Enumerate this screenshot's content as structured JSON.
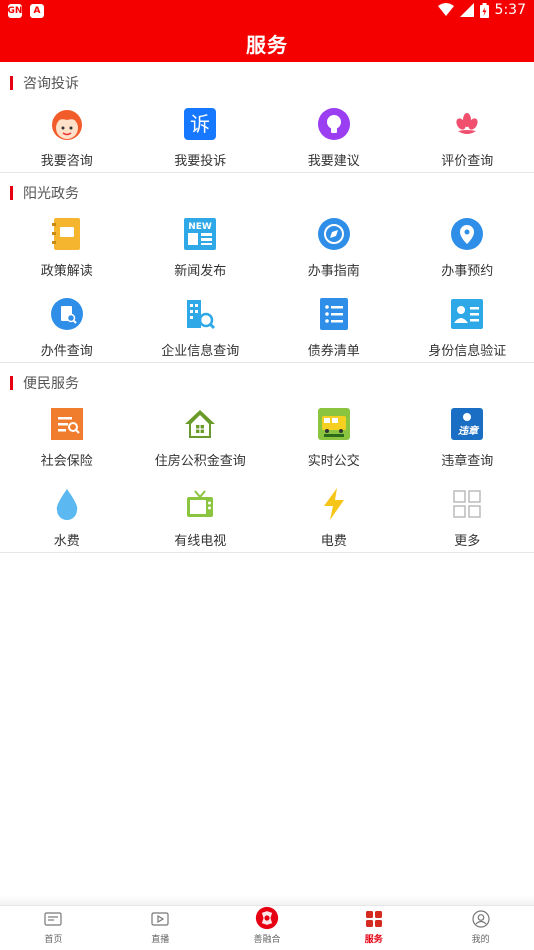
{
  "status": {
    "time": "5:37",
    "left_icons": [
      "GN",
      "A"
    ]
  },
  "header": {
    "title": "服务"
  },
  "sections": [
    {
      "title": "咨询投诉",
      "items": [
        {
          "label": "我要咨询",
          "icon": "avatar-face-icon"
        },
        {
          "label": "我要投诉",
          "icon": "complaint-icon"
        },
        {
          "label": "我要建议",
          "icon": "lightbulb-icon"
        },
        {
          "label": "评价查询",
          "icon": "flower-icon"
        }
      ]
    },
    {
      "title": "阳光政务",
      "items": [
        {
          "label": "政策解读",
          "icon": "notebook-icon"
        },
        {
          "label": "新闻发布",
          "icon": "newspaper-icon"
        },
        {
          "label": "办事指南",
          "icon": "compass-icon"
        },
        {
          "label": "办事预约",
          "icon": "location-pin-icon"
        },
        {
          "label": "办件查询",
          "icon": "document-search-icon"
        },
        {
          "label": "企业信息查询",
          "icon": "building-search-icon"
        },
        {
          "label": "债券清单",
          "icon": "list-icon"
        },
        {
          "label": "身份信息验证",
          "icon": "id-card-icon"
        }
      ]
    },
    {
      "title": "便民服务",
      "items": [
        {
          "label": "社会保险",
          "icon": "insurance-icon"
        },
        {
          "label": "住房公积金查询",
          "icon": "house-icon"
        },
        {
          "label": "实时公交",
          "icon": "bus-icon"
        },
        {
          "label": "违章查询",
          "icon": "traffic-violation-icon"
        },
        {
          "label": "水费",
          "icon": "water-drop-icon"
        },
        {
          "label": "有线电视",
          "icon": "tv-icon"
        },
        {
          "label": "电费",
          "icon": "lightning-icon"
        },
        {
          "label": "更多",
          "icon": "grid-more-icon"
        }
      ]
    }
  ],
  "icon_text": {
    "complaint": "诉",
    "news": "NEW",
    "violation": "违章"
  },
  "tabs": [
    {
      "label": "首页",
      "icon": "news-icon"
    },
    {
      "label": "直播",
      "icon": "play-icon"
    },
    {
      "label": "善融合",
      "icon": "brand-logo-icon"
    },
    {
      "label": "服务",
      "icon": "service-grid-icon",
      "active": true
    },
    {
      "label": "我的",
      "icon": "profile-icon"
    }
  ],
  "colors": {
    "brand": "#f40000",
    "accent": "#e60012"
  }
}
